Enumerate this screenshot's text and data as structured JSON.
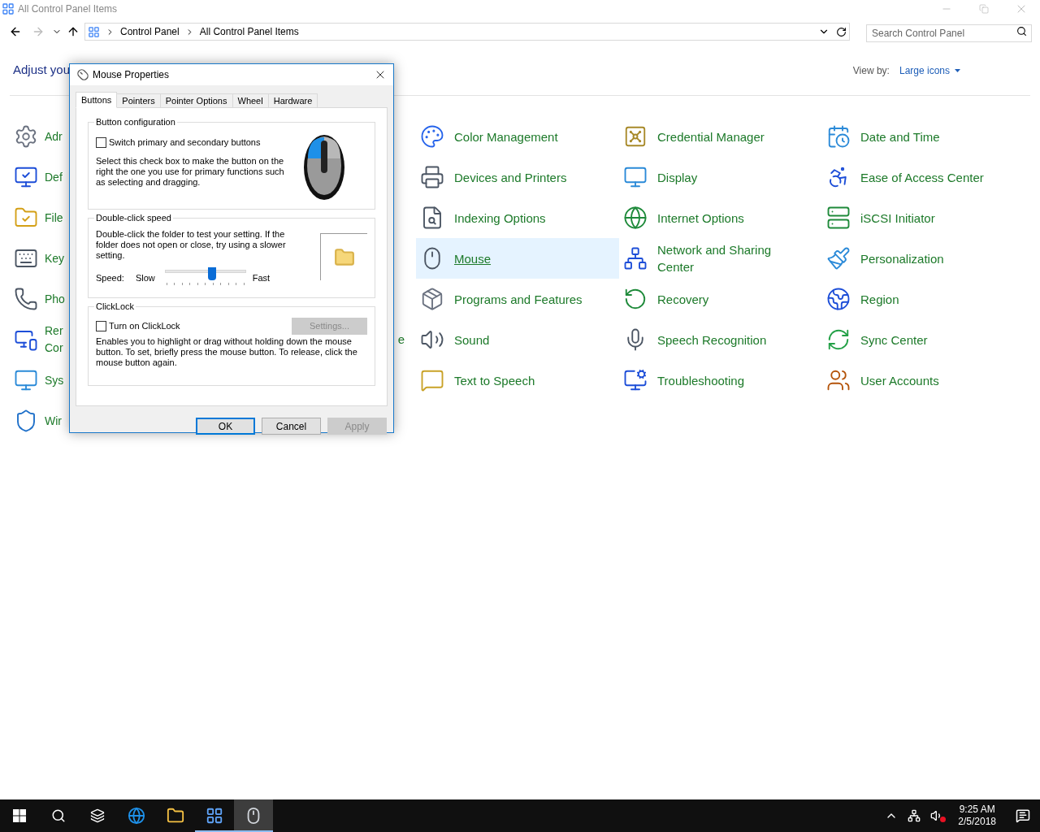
{
  "window": {
    "title": "All Control Panel Items"
  },
  "address_bar": {
    "crumbs": [
      "Control Panel",
      "All Control Panel Items"
    ],
    "forward_disabled": true
  },
  "search": {
    "placeholder": "Search Control Panel"
  },
  "header": {
    "title": "Adjust you",
    "view_by_label": "View by:",
    "view_by_value": "Large icons"
  },
  "columns": [
    [
      {
        "label": "Adr"
      },
      {
        "label": "Def"
      },
      {
        "label": "File"
      },
      {
        "label": "Key"
      },
      {
        "label": "Pho"
      },
      {
        "label": "Rer\nCor"
      },
      {
        "label": "Sys"
      },
      {
        "label": "Wir"
      }
    ],
    [
      {
        "label": "e"
      }
    ],
    [
      {
        "label": "Color Management",
        "selected": false
      },
      {
        "label": "Devices and Printers",
        "selected": false
      },
      {
        "label": "Indexing Options",
        "selected": false
      },
      {
        "label": "Mouse",
        "selected": true
      },
      {
        "label": "Programs and Features",
        "selected": false
      },
      {
        "label": "Sound",
        "selected": false
      },
      {
        "label": "Text to Speech",
        "selected": false
      }
    ],
    [
      {
        "label": "Credential Manager",
        "selected": false
      },
      {
        "label": "Display",
        "selected": false
      },
      {
        "label": "Internet Options",
        "selected": false
      },
      {
        "label": "Network and Sharing Center",
        "selected": false
      },
      {
        "label": "Recovery",
        "selected": false
      },
      {
        "label": "Speech Recognition",
        "selected": false
      },
      {
        "label": "Troubleshooting",
        "selected": false
      }
    ],
    [
      {
        "label": "Date and Time",
        "selected": false
      },
      {
        "label": "Ease of Access Center",
        "selected": false
      },
      {
        "label": "iSCSI Initiator",
        "selected": false
      },
      {
        "label": "Personalization",
        "selected": false
      },
      {
        "label": "Region",
        "selected": false
      },
      {
        "label": "Sync Center",
        "selected": false
      },
      {
        "label": "User Accounts",
        "selected": false
      }
    ]
  ],
  "dialog": {
    "title": "Mouse Properties",
    "tabs": [
      {
        "label": "Buttons",
        "selected": true
      },
      {
        "label": "Pointers",
        "selected": false
      },
      {
        "label": "Pointer Options",
        "selected": false
      },
      {
        "label": "Wheel",
        "selected": false
      },
      {
        "label": "Hardware",
        "selected": false
      }
    ],
    "button_configuration": {
      "title": "Button configuration",
      "checkbox": {
        "label": "Switch primary and secondary buttons",
        "checked": false
      },
      "description": "Select this check box to make the button on the right the one you use for primary functions such as selecting and dragging."
    },
    "double_click_speed": {
      "title": "Double-click speed",
      "description": "Double-click the folder to test your setting. If the folder does not open or close, try using a slower setting.",
      "speed_label": "Speed:",
      "slow_label": "Slow",
      "fast_label": "Fast",
      "level": 0.58
    },
    "clicklock": {
      "title": "ClickLock",
      "checkbox": {
        "label": "Turn on ClickLock",
        "checked": false
      },
      "settings_button": {
        "label": "Settings...",
        "disabled": true
      },
      "description": "Enables you to highlight or drag without holding down the mouse button. To set, briefly press the mouse button. To release, click the mouse button again."
    },
    "buttons": [
      {
        "label": "OK",
        "disabled": false,
        "default": true
      },
      {
        "label": "Cancel",
        "disabled": false,
        "default": false
      },
      {
        "label": "Apply",
        "disabled": true,
        "default": false
      }
    ]
  },
  "taskbar": {
    "apps": [
      {
        "running": false,
        "selected": false
      },
      {
        "running": false,
        "selected": false
      },
      {
        "running": true,
        "selected": false
      },
      {
        "running": true,
        "selected": true
      }
    ],
    "time": "9:25 AM",
    "date": "2/5/2018"
  }
}
